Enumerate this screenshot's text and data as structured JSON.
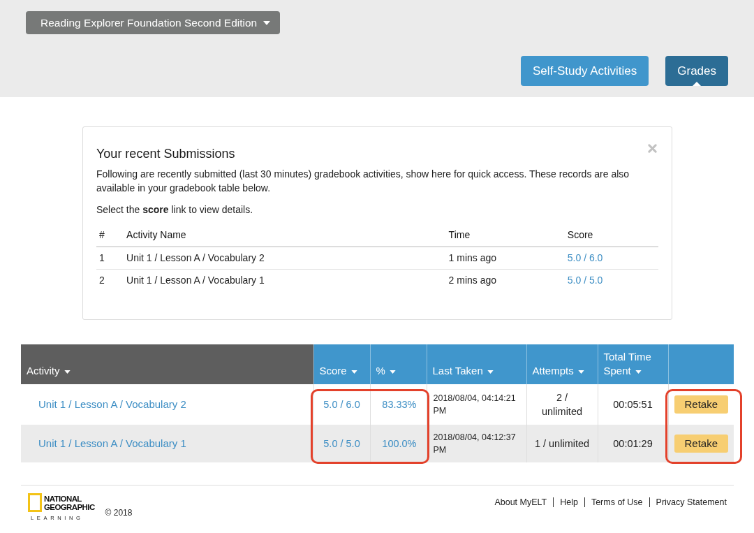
{
  "course_menu": {
    "label": "Reading Explorer Foundation Second Edition"
  },
  "nav": [
    {
      "label": "Self-Study Activities",
      "selected": false
    },
    {
      "label": "Grades",
      "selected": true
    }
  ],
  "recent_submissions": {
    "title": "Your recent Submissions",
    "description": "Following are recently submitted (last 30 minutes) gradebook activities, show here for quick access. These records are also available in your gradebook table below.",
    "hint": "Select the **score** link to view details.",
    "columns": [
      {
        "label": "#",
        "kind": "text"
      },
      {
        "label": "Activity Name",
        "kind": "text"
      },
      {
        "label": "Time",
        "kind": "text"
      },
      {
        "label": "Score",
        "kind": "link"
      }
    ],
    "rows": [
      {
        "cells": [
          "1",
          "Unit 1 / Lesson A / Vocabulary 2",
          "1 mins ago",
          "5.0 / 6.0"
        ]
      },
      {
        "cells": [
          "2",
          "Unit 1 / Lesson A / Vocabulary 1",
          "2 mins ago",
          "5.0 / 5.0"
        ]
      }
    ]
  },
  "gradebook": {
    "columns": [
      {
        "label": "Activity",
        "kind": "link",
        "sortable": true,
        "selected": true,
        "highlighted": false
      },
      {
        "label": "Score",
        "kind": "link",
        "sortable": true,
        "selected": false,
        "highlighted": true
      },
      {
        "label": "%",
        "kind": "link",
        "sortable": true,
        "selected": false,
        "highlighted": true
      },
      {
        "label": "Last Taken",
        "kind": "text",
        "sortable": true,
        "selected": false,
        "highlighted": false
      },
      {
        "label": "Attempts",
        "kind": "text",
        "sortable": true,
        "selected": false,
        "highlighted": false
      },
      {
        "label": "Total Time Spent",
        "kind": "text",
        "sortable": true,
        "selected": false,
        "highlighted": false
      },
      {
        "kind": "action",
        "sortable": false,
        "selected": false,
        "highlighted": true
      }
    ],
    "rows": [
      {
        "cells": [
          "Unit 1 / Lesson A / Vocabulary 2",
          "5.0 / 6.0",
          "83.33%",
          "2018/08/04, 04:14:21 PM",
          "2 /\nunlimited",
          "00:05:51",
          "Retake"
        ]
      },
      {
        "cells": [
          "Unit 1 / Lesson A / Vocabulary 1",
          "5.0 / 5.0",
          "100.0%",
          "2018/08/04, 04:12:37 PM",
          "1 / unlimited",
          "00:01:29",
          "Retake"
        ]
      }
    ]
  },
  "footer": {
    "logo": {
      "title": "NATIONAL GEOGRAPHIC",
      "subtitle": "LEARNING"
    },
    "copyright": "© 2018",
    "links": [
      "About MyELT",
      "Help",
      "Terms of Use",
      "Privacy Statement"
    ]
  }
}
